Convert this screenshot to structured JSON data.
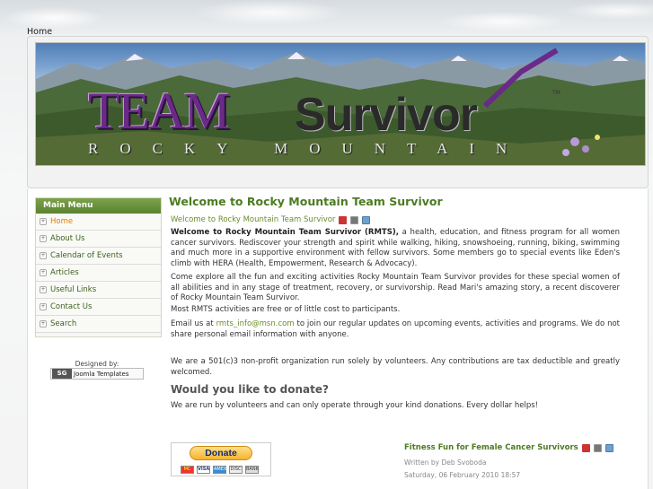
{
  "breadcrumb": "Home",
  "banner": {
    "team": "TEAM",
    "survivor": "Survivor",
    "tagline": "ROCKY MOUNTAIN",
    "tm": "TM"
  },
  "menu": {
    "header": "Main Menu",
    "items": [
      {
        "label": "Home",
        "active": true
      },
      {
        "label": "About Us"
      },
      {
        "label": "Calendar of Events"
      },
      {
        "label": "Articles"
      },
      {
        "label": "Useful Links"
      },
      {
        "label": "Contact Us"
      },
      {
        "label": "Search"
      }
    ]
  },
  "designed": {
    "label": "Designed by:",
    "badge": "SG",
    "name": "Joomla Templates"
  },
  "article": {
    "title": "Welcome to Rocky Mountain Team Survivor",
    "link": "Welcome to Rocky Mountain Team Survivor",
    "p1_bold": "Welcome to Rocky Mountain Team Survivor (RMTS),",
    "p1_rest": " a health, education, and fitness program for all women cancer survivors. Rediscover your strength and spirit while walking, hiking, snowshoeing, running, biking, swimming and much more in a supportive environment with fellow survivors. Some members go to special events like Eden's climb with HERA (Health, Empowerment, Research & Advocacy).",
    "p2": "Come explore all the fun and exciting activities Rocky Mountain Team Survivor provides for these special women of all abilities and in any stage of treatment, recovery, or survivorship. Read Mari's amazing story, a recent discoverer of Rocky Mountain Team Survivor.",
    "p3": "Most RMTS activities are free or of little cost to participants.",
    "p4_pre": "Email us at ",
    "p4_email": "rmts_info@msn.com",
    "p4_post": " to join our regular updates on upcoming events, activities and programs. We do not share personal email information with anyone.",
    "p5": "We are a 501(c)3 non-profit organization run solely by volunteers. Any contributions are tax deductible and greatly welcomed.",
    "donate_heading": "Would you like to donate?",
    "p6": "We are run by volunteers and can only operate through your kind donations.  Every dollar helps!"
  },
  "donate": {
    "button": "Donate",
    "cards": [
      "MC",
      "VISA",
      "AMEX",
      "DISC",
      "BANK"
    ]
  },
  "next_article": {
    "title": "Fitness Fun for Female Cancer Survivors",
    "author": "Written by Deb Svoboda",
    "date": "Saturday, 06 February 2010 18:57"
  },
  "colors": {
    "accent_green": "#4c7b21",
    "menu_green": "#5a8230",
    "active_orange": "#e07b00",
    "logo_purple": "#6a2a88"
  }
}
